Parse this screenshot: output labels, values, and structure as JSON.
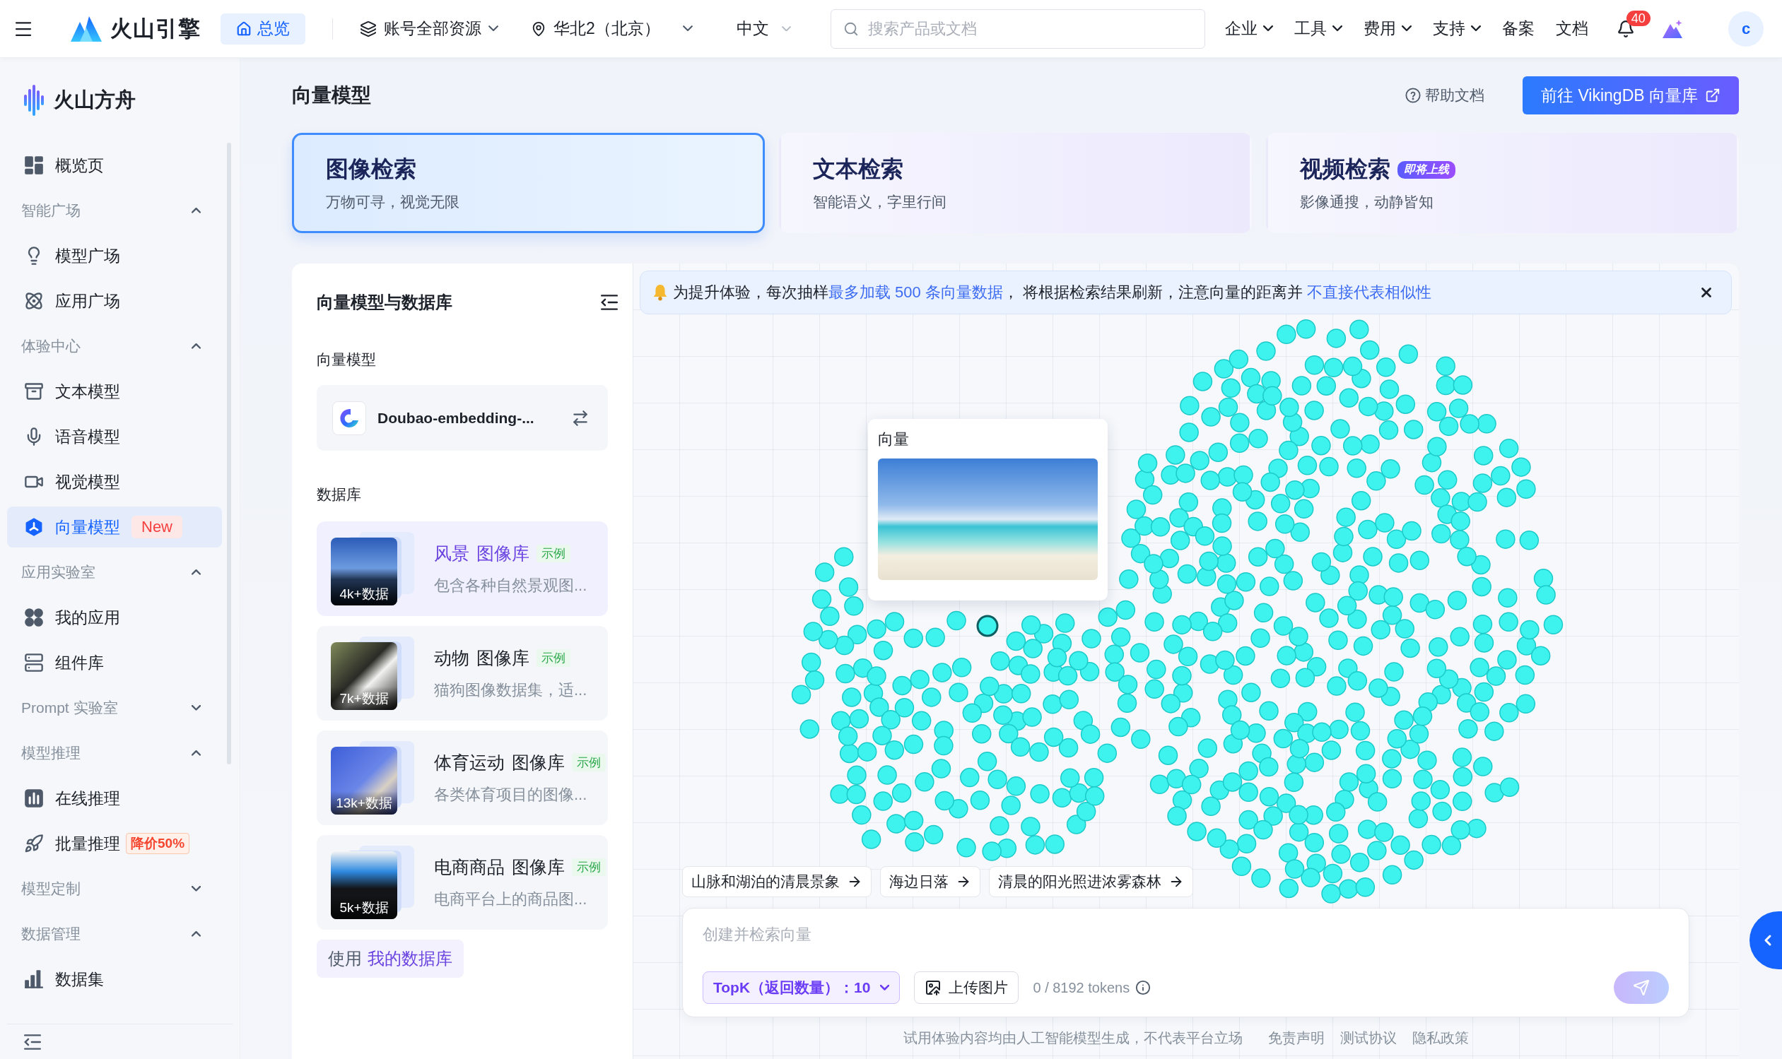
{
  "topbar": {
    "brand": "火山引擎",
    "home": {
      "label": "总览",
      "selected": true
    },
    "account_scope": "账号全部资源",
    "region": "华北2（北京）",
    "language": "中文",
    "search": {
      "placeholder": "搜索产品或文档"
    },
    "menus": [
      {
        "label": "企业",
        "kind": "dropdown"
      },
      {
        "label": "工具",
        "kind": "dropdown"
      },
      {
        "label": "费用",
        "kind": "dropdown"
      },
      {
        "label": "支持",
        "kind": "dropdown"
      },
      {
        "label": "备案",
        "kind": "link"
      },
      {
        "label": "文档",
        "kind": "link"
      }
    ],
    "notifications": "40",
    "avatar": "c"
  },
  "sidebar": {
    "title": "火山方舟",
    "nav": [
      {
        "kind": "item",
        "label": "概览页",
        "selected": false
      },
      {
        "kind": "section",
        "label": "智能广场",
        "expanded": true,
        "children": [
          {
            "label": "模型广场",
            "selected": false
          },
          {
            "label": "应用广场",
            "selected": false
          }
        ]
      },
      {
        "kind": "section",
        "label": "体验中心",
        "expanded": true,
        "children": [
          {
            "label": "文本模型",
            "selected": false
          },
          {
            "label": "语音模型",
            "selected": false
          },
          {
            "label": "视觉模型",
            "selected": false
          },
          {
            "label": "向量模型",
            "selected": true,
            "badge": {
              "kind": "new",
              "text": "New"
            }
          }
        ]
      },
      {
        "kind": "section",
        "label": "应用实验室",
        "expanded": true,
        "children": [
          {
            "label": "我的应用",
            "selected": false
          },
          {
            "label": "组件库",
            "selected": false
          }
        ]
      },
      {
        "kind": "section",
        "label": "Prompt 实验室",
        "expanded": false
      },
      {
        "kind": "section",
        "label": "模型推理",
        "expanded": true,
        "children": [
          {
            "label": "在线推理",
            "selected": false
          },
          {
            "label": "批量推理",
            "selected": false,
            "badge": {
              "kind": "discount",
              "text": "降价50%"
            }
          }
        ]
      },
      {
        "kind": "section",
        "label": "模型定制",
        "expanded": false
      },
      {
        "kind": "section",
        "label": "数据管理",
        "expanded": true,
        "children": [
          {
            "label": "数据集",
            "selected": false
          }
        ]
      }
    ]
  },
  "page": {
    "title": "向量模型",
    "help": "帮助文档",
    "primary_button": "前往 VikingDB 向量库"
  },
  "modes": [
    {
      "title": "图像检索",
      "subtitle": "万物可寻，视觉无限",
      "selected": true
    },
    {
      "title": "文本检索",
      "subtitle": "智能语义，字里行间",
      "selected": false
    },
    {
      "title": "视频检索",
      "subtitle": "影像通搜，动静皆知",
      "selected": false,
      "badge": "即将上线"
    }
  ],
  "panel": {
    "title": "向量模型与数据库",
    "model_label": "向量模型",
    "model": "Doubao-embedding-...",
    "database_label": "数据库",
    "databases": [
      {
        "name": "风景",
        "type": "图像库",
        "tag": "示例",
        "description": "包含各种自然景观图...",
        "count": "4k+数据",
        "selected": true
      },
      {
        "name": "动物",
        "type": "图像库",
        "tag": "示例",
        "description": "猫狗图像数据集，适...",
        "count": "7k+数据",
        "selected": false
      },
      {
        "name": "体育运动",
        "type": "图像库",
        "tag": "示例",
        "description": "各类体育项目的图像...",
        "count": "13k+数据",
        "selected": false
      },
      {
        "name": "电商商品",
        "type": "图像库",
        "tag": "示例",
        "description": "电商平台上的商品图...",
        "count": "5k+数据",
        "selected": false
      }
    ],
    "my_database": {
      "prefix": "使用",
      "link": "我的数据库"
    }
  },
  "canvas": {
    "notice": "为提升体验，每次抽样**最多加载 500 条向量数据**， 将根据检索结果刷新，注意向量的距离并 **不直接代表相似性**",
    "tooltip": {
      "title": "向量"
    },
    "suggestions": [
      "山脉和湖泊的清晨景象",
      "海边日落",
      "清晨的阳光照进浓雾森林"
    ],
    "composer": {
      "placeholder": "创建并检索向量",
      "topk": "TopK（返回数量）：10",
      "upload": "上传图片",
      "tokens": "0 / 8192 tokens",
      "send": {
        "disabled": true
      }
    },
    "footer": {
      "note": "试用体验内容均由人工智能模型生成，不代表平台立场",
      "links": [
        "免责声明",
        "测试协议",
        "隐私政策"
      ]
    }
  }
}
